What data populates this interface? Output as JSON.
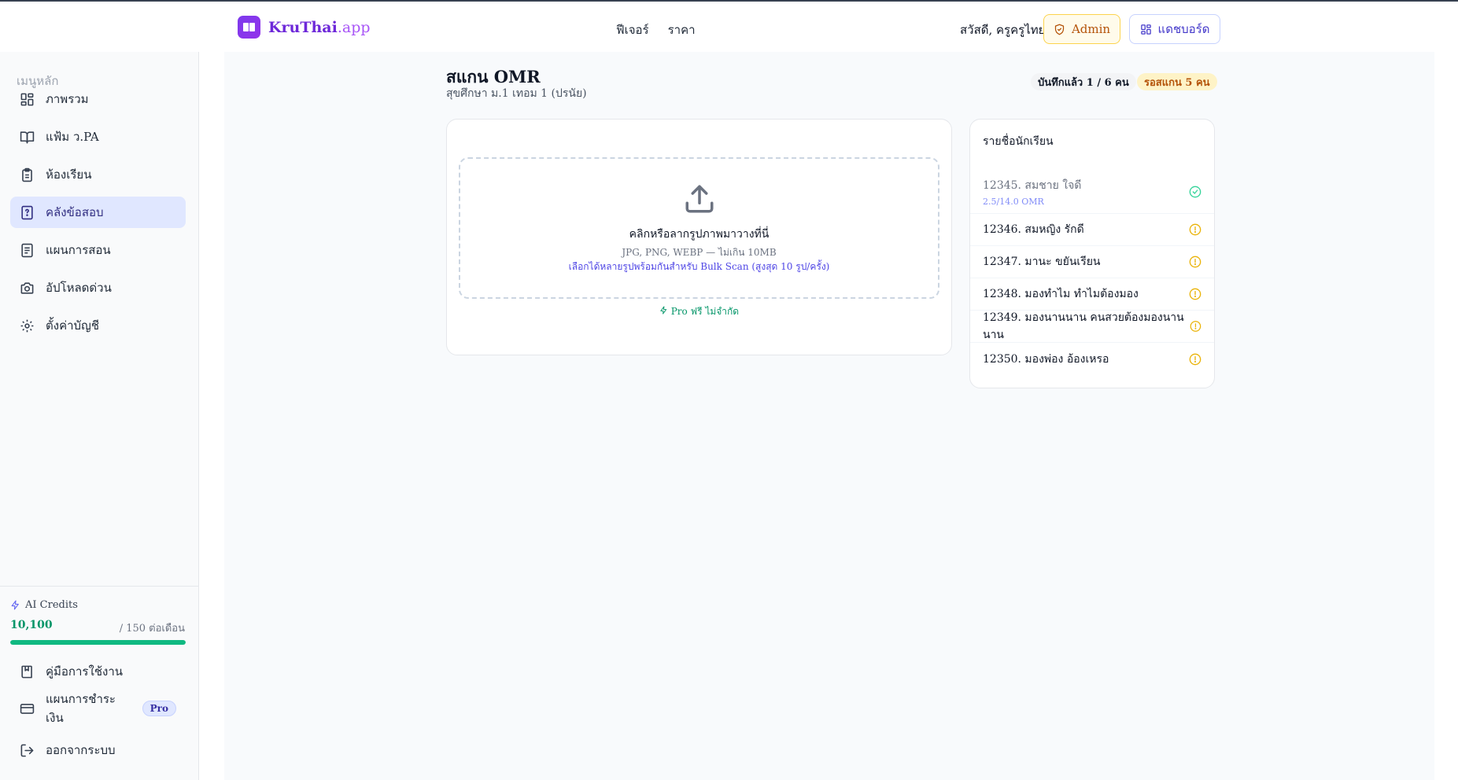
{
  "header": {
    "brand_main": "KruThai",
    "brand_suffix": ".app",
    "nav": [
      "ฟีเจอร์",
      "ราคา"
    ],
    "greeting": "สวัสดี, ครูครูไทย",
    "admin_label": "Admin",
    "dashboard_label": "แดชบอร์ด"
  },
  "sidebar": {
    "heading": "เมนูหลัก",
    "items": [
      {
        "label": "ภาพรวม",
        "icon": "grid-icon"
      },
      {
        "label": "แฟ้ม ว.PA",
        "icon": "book-open-icon"
      },
      {
        "label": "ห้องเรียน",
        "icon": "clipboard-icon"
      },
      {
        "label": "คลังข้อสอบ",
        "icon": "question-file-icon",
        "active": true
      },
      {
        "label": "แผนการสอน",
        "icon": "document-icon"
      },
      {
        "label": "อัปโหลดด่วน",
        "icon": "camera-icon"
      },
      {
        "label": "ตั้งค่าบัญชี",
        "icon": "gear-icon"
      }
    ],
    "credits": {
      "label": "AI Credits",
      "value": "10,100",
      "max": "/ 150 ต่อเดือน",
      "progress": 1.0
    },
    "bottom": {
      "guide": "คู่มือการใช้งาน",
      "billing": "แผนการชำระเงิน",
      "billing_badge": "Pro",
      "logout": "ออกจากระบบ"
    }
  },
  "main": {
    "title": "สแกน OMR",
    "subtitle": "สุขศึกษา ม.1 เทอม 1 (ปรนัย)",
    "badge_saved": "บันทึกแล้ว 1 / 6 คน",
    "badge_waiting": "รอสแกน 5 คน",
    "upload": {
      "title": "คลิกหรือลากรูปภาพมาวางที่นี่",
      "formats": "JPG, PNG, WEBP — ไม่เกิน 10MB",
      "bulk_hint": "เลือกได้หลายรูปพร้อมกันสำหรับ Bulk Scan (สูงสุด 10 รูป/ครั้ง)",
      "pro_note": "Pro ฟรี ไม่จำกัด"
    },
    "students": {
      "heading": "รายชื่อนักเรียน",
      "rows": [
        {
          "name": "12345. สมชาย ใจดี",
          "score": "2.5/14.0 OMR",
          "status": "done"
        },
        {
          "name": "12346. สมหญิง รักดี",
          "status": "pending"
        },
        {
          "name": "12347. มานะ ขยันเรียน",
          "status": "pending"
        },
        {
          "name": "12348. มองทำไม ทำไมต้องมอง",
          "status": "pending"
        },
        {
          "name": "12349. มองนานนาน คนสวยต้องมองนานนาน",
          "status": "pending"
        },
        {
          "name": "12350. มองพ่อง อ้องเหรอ",
          "status": "pending"
        }
      ]
    }
  },
  "colors": {
    "accent": "#6d28d9",
    "active_bg": "#e0e7ff",
    "success": "#10b981",
    "warning": "#eab308"
  }
}
